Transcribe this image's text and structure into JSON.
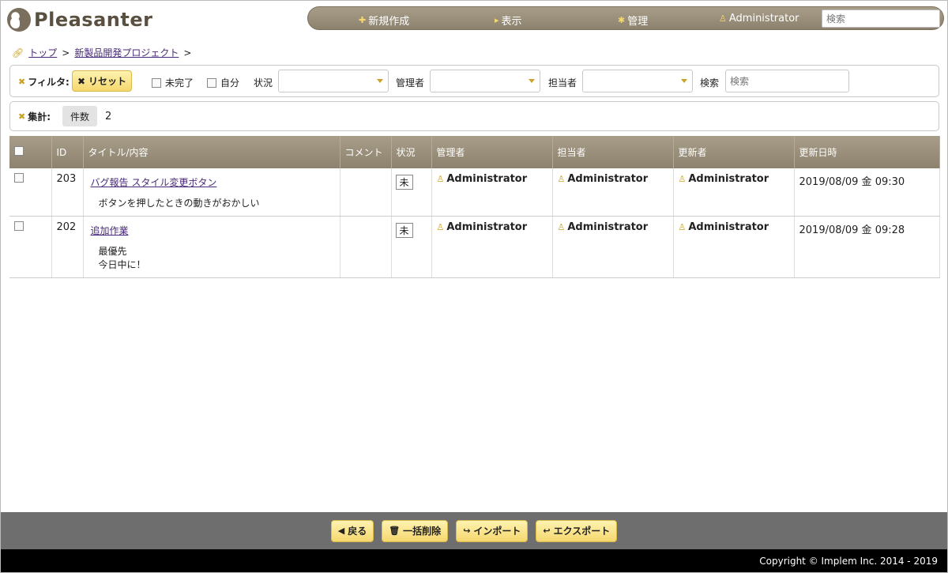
{
  "app": {
    "logo_text": "Pleasanter"
  },
  "nav": {
    "new_label": "新規作成",
    "view_label": "表示",
    "manage_label": "管理",
    "user_label": "Administrator",
    "search_placeholder": "検索"
  },
  "breadcrumb": {
    "top": "トップ",
    "project": "新製品開発プロジェクト",
    "separator": ">"
  },
  "filter": {
    "label": "フィルタ:",
    "reset_label": "リセット",
    "incomplete_label": "未完了",
    "self_label": "自分",
    "status_label": "状況",
    "manager_label": "管理者",
    "owner_label": "担当者",
    "search_label": "検索",
    "search_placeholder": "検索"
  },
  "summary": {
    "label": "集計:",
    "count_label": "件数",
    "count_value": "2"
  },
  "grid": {
    "columns": [
      "ID",
      "タイトル/内容",
      "コメント",
      "状況",
      "管理者",
      "担当者",
      "更新者",
      "更新日時"
    ],
    "rows": [
      {
        "id": "203",
        "title": "バグ報告 スタイル変更ボタン",
        "body": "ボタンを押したときの動きがおかしい",
        "comment": "",
        "status": "未",
        "manager": "Administrator",
        "owner": "Administrator",
        "updater": "Administrator",
        "updated": "2019/08/09 金 09:30"
      },
      {
        "id": "202",
        "title": "追加作業",
        "body": "最優先\n今日中に！",
        "comment": "",
        "status": "未",
        "manager": "Administrator",
        "owner": "Administrator",
        "updater": "Administrator",
        "updated": "2019/08/09 金 09:28"
      }
    ]
  },
  "footer": {
    "back_label": "戻る",
    "bulk_delete_label": "一括削除",
    "import_label": "インポート",
    "export_label": "エクスポート",
    "copyright": "Copyright © Implem Inc. 2014 - 2019"
  },
  "colors": {
    "accent": "#f5d76e",
    "header": "#9a8f7a",
    "footer": "#6e6e6e"
  }
}
